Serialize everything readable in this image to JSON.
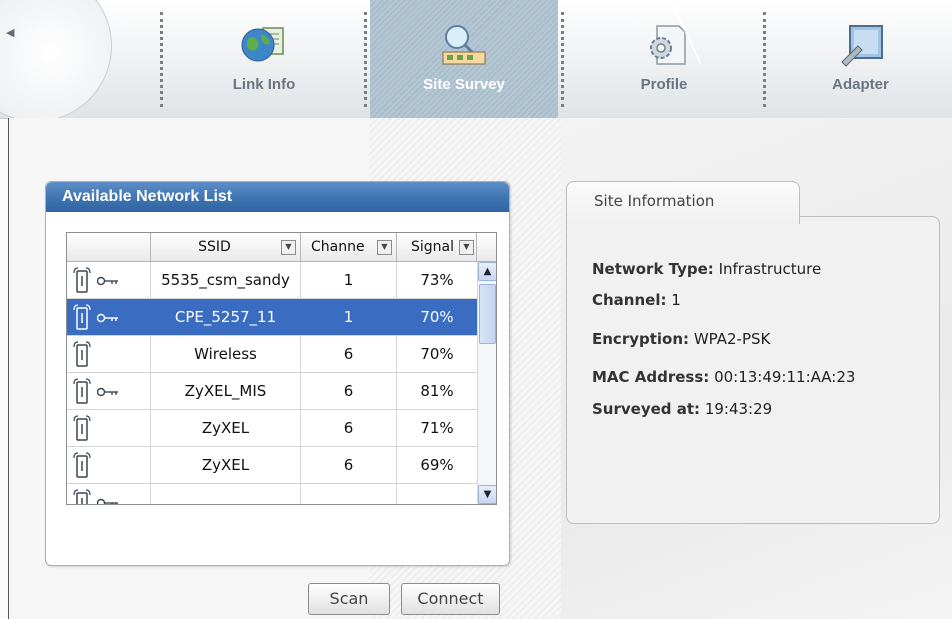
{
  "nav": {
    "tabs": [
      {
        "label": "Link Info",
        "icon": "globe-document-icon",
        "active": false
      },
      {
        "label": "Site Survey",
        "icon": "network-search-icon",
        "active": true
      },
      {
        "label": "Profile",
        "icon": "gear-document-icon",
        "active": false
      },
      {
        "label": "Adapter",
        "icon": "adapter-tool-icon",
        "active": false
      }
    ]
  },
  "network_list": {
    "title": "Available Network List",
    "columns": [
      "SSID",
      "Channe",
      "Signal"
    ],
    "rows": [
      {
        "ssid": "5535_csm_sandy",
        "channel": "1",
        "signal": "73%",
        "secured": true,
        "selected": false
      },
      {
        "ssid": "CPE_5257_11",
        "channel": "1",
        "signal": "70%",
        "secured": true,
        "selected": true
      },
      {
        "ssid": "Wireless",
        "channel": "6",
        "signal": "70%",
        "secured": false,
        "selected": false
      },
      {
        "ssid": "ZyXEL_MIS",
        "channel": "6",
        "signal": "81%",
        "secured": true,
        "selected": false
      },
      {
        "ssid": "ZyXEL",
        "channel": "6",
        "signal": "71%",
        "secured": false,
        "selected": false
      },
      {
        "ssid": "ZyXEL",
        "channel": "6",
        "signal": "69%",
        "secured": false,
        "selected": false
      },
      {
        "ssid": "",
        "channel": "",
        "signal": "",
        "secured": true,
        "selected": false
      }
    ],
    "scan_label": "Scan",
    "connect_label": "Connect"
  },
  "site_info": {
    "tab_label": "Site Information",
    "network_type_label": "Network Type:",
    "network_type": "Infrastructure",
    "channel_label": "Channel:",
    "channel": "1",
    "encryption_label": "Encryption:",
    "encryption": "WPA2-PSK",
    "mac_label": "MAC Address:",
    "mac": "00:13:49:11:AA:23",
    "surveyed_label": "Surveyed at:",
    "surveyed": "19:43:29"
  },
  "colors": {
    "panel_header": "#3e74b2",
    "selected_row": "#3a6cc1",
    "active_tab": "#b1c3d1"
  }
}
